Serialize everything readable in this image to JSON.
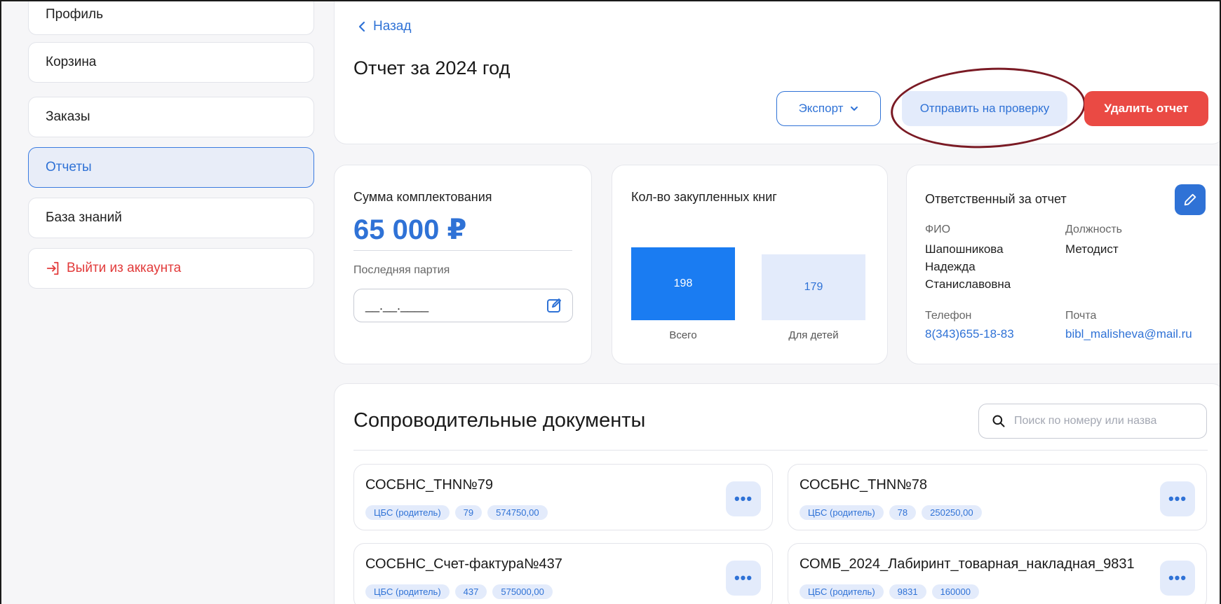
{
  "sidebar": {
    "items": [
      {
        "label": "Профиль"
      },
      {
        "label": "Корзина"
      },
      {
        "label": "Заказы"
      },
      {
        "label": "Отчеты"
      },
      {
        "label": "База знаний"
      },
      {
        "label": "Выйти из аккаунта"
      }
    ]
  },
  "header": {
    "back_label": "Назад",
    "title": "Отчет за 2024 год",
    "export_label": "Экспорт",
    "send_label": "Отправить на проверку",
    "delete_label": "Удалить отчет"
  },
  "sum_card": {
    "title": "Сумма комплектования",
    "amount": "65 000 ₽",
    "last_batch_label": "Последняя партия",
    "date_value": "__.__.____"
  },
  "books_card": {
    "title": "Кол-во закупленных книг",
    "total_value": "198",
    "total_label": "Всего",
    "kids_value": "179",
    "kids_label": "Для детей"
  },
  "responsible_card": {
    "title": "Ответственный за отчет",
    "fio_label": "ФИО",
    "fio_value_1": "Шапошникова",
    "fio_value_2": "Надежда",
    "fio_value_3": "Станиславовна",
    "position_label": "Должность",
    "position_value": "Методист",
    "phone_label": "Телефон",
    "phone_value": "8(343)655-18-83",
    "email_label": "Почта",
    "email_value": "bibl_malisheva@mail.ru"
  },
  "docs": {
    "title": "Сопроводительные документы",
    "search_placeholder": "Поиск по номеру или назва",
    "items": [
      {
        "name": "СОСБНС_ТНN№79",
        "tags": [
          "ЦБС (родитель)",
          "79",
          "574750,00"
        ]
      },
      {
        "name": "СОСБНС_ТНN№78",
        "tags": [
          "ЦБС (родитель)",
          "78",
          "250250,00"
        ]
      },
      {
        "name": "СОСБНС_Счет-фактура№437",
        "tags": [
          "ЦБС (родитель)",
          "437",
          "575000,00"
        ]
      },
      {
        "name": "СОМБ_2024_Лабиринт_товарная_накладная_9831",
        "tags": [
          "ЦБС (родитель)",
          "9831",
          "160000"
        ]
      }
    ]
  },
  "colors": {
    "accent": "#2f72d6",
    "danger": "#ea4a44",
    "annotation": "#7a1a24"
  }
}
